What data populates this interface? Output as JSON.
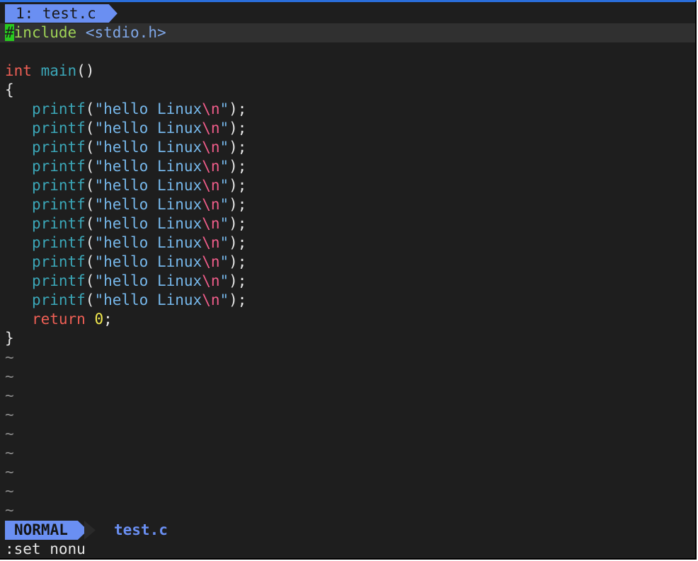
{
  "tabline": {
    "tab_label": "1: test.c"
  },
  "code": {
    "include": {
      "cursor_char": "#",
      "directive": "include",
      "header": "<stdio.h>"
    },
    "main_sig": {
      "type": "int",
      "name": "main",
      "parens": "()"
    },
    "open_brace": "{",
    "printf_line": {
      "fn": "printf",
      "open": "(",
      "quote_open": "\"",
      "text": "hello Linux",
      "escape": "\\n",
      "quote_close": "\"",
      "close": ");"
    },
    "printf_count": 11,
    "return_line": {
      "kw": "return",
      "value": "0",
      "end": ";"
    },
    "close_brace": "}",
    "tilde": "~",
    "tilde_count": 9
  },
  "statusline": {
    "mode": "NORMAL",
    "filename": "test.c"
  },
  "cmdline": {
    "text": ":set nonu"
  },
  "colors": {
    "background": "#1e1e1e",
    "accent": "#6a8ff2",
    "cursor": "#28c91f",
    "keyword": "#ef5f55",
    "function": "#3ba7b8",
    "string": "#76b7ea",
    "escape": "#f05d8a",
    "number": "#f2e94e"
  }
}
